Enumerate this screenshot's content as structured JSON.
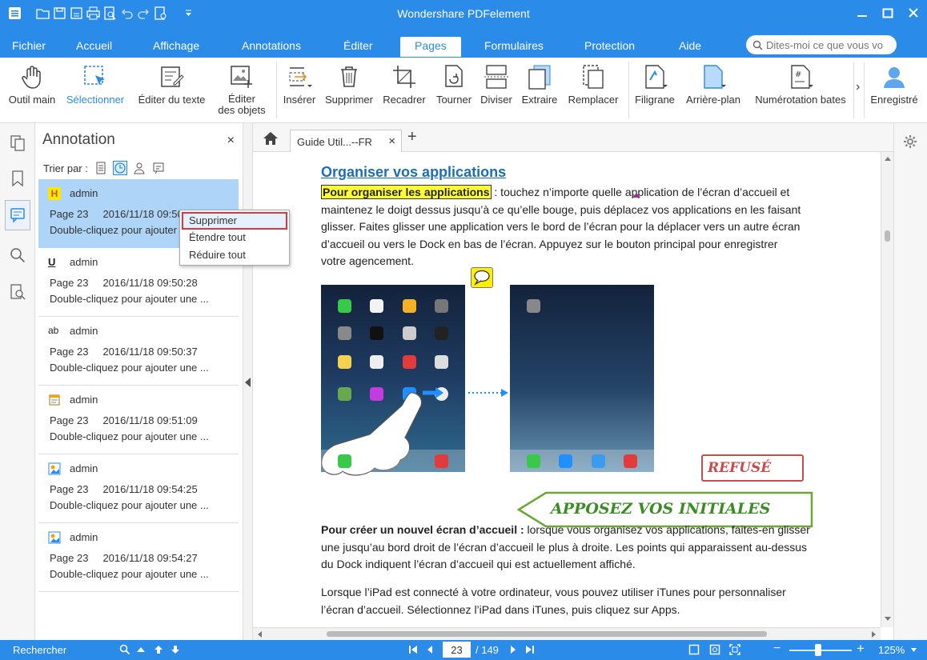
{
  "app": {
    "title": "Wondershare PDFelement"
  },
  "menu": {
    "tabs": [
      "Fichier",
      "Accueil",
      "Affichage",
      "Annotations",
      "Éditer",
      "Pages",
      "Formulaires",
      "Protection",
      "Aide"
    ],
    "active_tab": "Pages",
    "search_placeholder": "Dites-moi ce que vous vo"
  },
  "ribbon": {
    "buttons": [
      {
        "label": "Outil main",
        "icon": "hand-icon"
      },
      {
        "label": "Sélectionner",
        "icon": "select-cursor-icon"
      },
      {
        "label": "Éditer du texte",
        "icon": "edit-text-icon"
      },
      {
        "label": "Éditer",
        "label2": "des objets",
        "icon": "edit-objects-icon"
      },
      {
        "label": "Insérer",
        "icon": "insert-page-icon"
      },
      {
        "label": "Supprimer",
        "icon": "trash-icon"
      },
      {
        "label": "Recadrer",
        "icon": "crop-icon"
      },
      {
        "label": "Tourner",
        "icon": "rotate-icon"
      },
      {
        "label": "Diviser",
        "icon": "split-icon"
      },
      {
        "label": "Extraire",
        "icon": "extract-icon"
      },
      {
        "label": "Remplacer",
        "icon": "replace-icon"
      },
      {
        "label": "Filigrane",
        "icon": "watermark-icon"
      },
      {
        "label": "Arrière-plan",
        "icon": "background-icon"
      },
      {
        "label": "Numérotation bates",
        "icon": "bates-numbering-icon"
      },
      {
        "label": "Enregistré",
        "icon": "user-icon"
      }
    ],
    "more_glyph": "›"
  },
  "annotation_panel": {
    "title": "Annotation",
    "close_glyph": "×",
    "sort_label": "Trier par :",
    "items": [
      {
        "type_icon": "highlight-icon",
        "type_glyph": "H",
        "author": "admin",
        "page": "Page 23",
        "date": "2016/11/18 09:50:25",
        "hint": "Double-cliquez pour ajouter une ..."
      },
      {
        "type_icon": "underline-icon",
        "type_glyph": "U",
        "author": "admin",
        "page": "Page 23",
        "date": "2016/11/18 09:50:28",
        "hint": "Double-cliquez pour ajouter une ..."
      },
      {
        "type_icon": "replace-text-icon",
        "type_glyph": "ab",
        "author": "admin",
        "page": "Page 23",
        "date": "2016/11/18 09:50:37",
        "hint": "Double-cliquez pour ajouter une ..."
      },
      {
        "type_icon": "note-icon",
        "type_glyph": "",
        "author": "admin",
        "page": "Page 23",
        "date": "2016/11/18 09:51:09",
        "hint": "Double-cliquez pour ajouter une ..."
      },
      {
        "type_icon": "stamp-icon",
        "type_glyph": "",
        "author": "admin",
        "page": "Page 23",
        "date": "2016/11/18 09:54:25",
        "hint": "Double-cliquez pour ajouter une ..."
      },
      {
        "type_icon": "stamp-icon",
        "type_glyph": "",
        "author": "admin",
        "page": "Page 23",
        "date": "2016/11/18 09:54:27",
        "hint": "Double-cliquez pour ajouter une ..."
      }
    ]
  },
  "context_menu": {
    "items": [
      "Supprimer",
      "Étendre tout",
      "Réduire tout"
    ]
  },
  "doc_tab": {
    "label": "Guide Util...--FR",
    "close_glyph": "×",
    "new_glyph": "+"
  },
  "document": {
    "heading": "Organiser vos applications",
    "p1_highlight": "Pour organiser les applications",
    "p1_line1": " : touchez n’importe quelle application de l’écran d’accueil et",
    "p1_line2": "maintenez le doigt dessus jusqu’à ce qu’elle bouge, puis déplacez vos applications en les faisant",
    "p1_line3": "glisser. Faites glisser une application vers le bord de l’écran pour la déplacer vers un autre écran",
    "p1_line4": "d’accueil ou vers le Dock en bas de l’écran. Appuyez sur le bouton principal pour enregistrer",
    "p1_line5": "votre agencement.",
    "stamp_refuse": "REFUSÉ",
    "stamp_initials": "APPOSEZ VOS INITIALES",
    "p2_bold": "Pour créer un nouvel écran d’accueil :",
    "p2_line1": " lorsque vous organisez vos applications, faites-en glisser",
    "p2_line2": "une jusqu’au bord droit de l’écran d’accueil le plus à droite. Les points qui apparaissent au-dessus",
    "p2_line3": "du Dock indiquent l’écran d’accueil qui est actuellement affiché.",
    "p3_line1": "Lorsque l’iPad est connecté à votre ordinateur, vous pouvez utiliser iTunes pour personnaliser",
    "p3_line2": "l’écran d’accueil. Sélectionnez l’iPad dans iTunes, puis cliquez sur Apps."
  },
  "status": {
    "search_label": "Rechercher",
    "page_current": "23",
    "page_total": "/ 149",
    "zoom_level": "125%",
    "zoom_fraction": 0.46,
    "zoom_minus": "−",
    "zoom_plus": "+"
  },
  "colors": {
    "accent": "#2a8be8",
    "selection": "#aed4f7",
    "context_highlight": "#d53b3b",
    "refuse": "#c94c4c",
    "initials": "#3c8c26",
    "highlight": "#ffff33"
  }
}
